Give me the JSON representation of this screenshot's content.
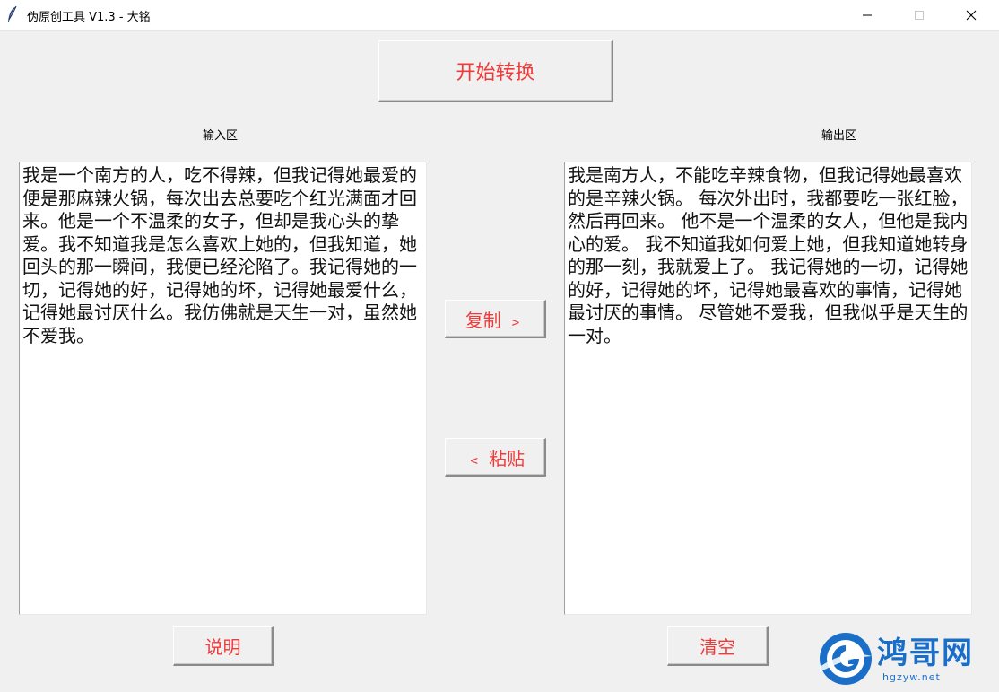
{
  "window": {
    "title": "伪原创工具 V1.3 - 大铭"
  },
  "buttons": {
    "start": "开始转换",
    "copy": "复制 ﹥",
    "paste": "﹤ 粘贴",
    "help": "说明",
    "clear": "清空"
  },
  "labels": {
    "input": "输入区",
    "output": "输出区"
  },
  "input_text": "我是一个南方的人，吃不得辣，但我记得她最爱的便是那麻辣火锅，每次出去总要吃个红光满面才回来。他是一个不温柔的女子，但却是我心头的挚爱。我不知道我是怎么喜欢上她的，但我知道，她回头的那一瞬间，我便已经沦陷了。我记得她的一切，记得她的好，记得她的坏，记得她最爱什么，记得她最讨厌什么。我仿佛就是天生一对，虽然她不爱我。",
  "output_text": "我是南方人，不能吃辛辣食物，但我记得她最喜欢的是辛辣火锅。 每次外出时，我都要吃一张红脸，然后再回来。 他不是一个温柔的女人，但他是我内心的爱。 我不知道我如何爱上她，但我知道她转身的那一刻，我就爱上了。 我记得她的一切，记得她的好，记得她的坏，记得她最喜欢的事情，记得她最讨厌的事情。 尽管她不爱我，但我似乎是天生的一对。",
  "watermark": {
    "name": "鸿哥网",
    "url": "hgzyw.net"
  },
  "colors": {
    "button_text": "#f03a3a",
    "watermark": "#1a6ec8"
  }
}
